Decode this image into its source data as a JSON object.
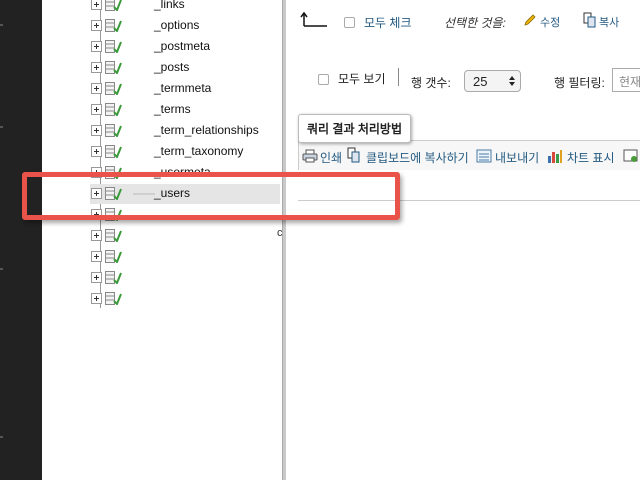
{
  "sidebar": {
    "tables": [
      {
        "name": "_links",
        "selected": false
      },
      {
        "name": "_options",
        "selected": false
      },
      {
        "name": "_postmeta",
        "selected": false
      },
      {
        "name": "_posts",
        "selected": false
      },
      {
        "name": "_termmeta",
        "selected": false
      },
      {
        "name": "_terms",
        "selected": false
      },
      {
        "name": "_term_relationships",
        "selected": false
      },
      {
        "name": "_term_taxonomy",
        "selected": false
      },
      {
        "name": "_usermeta",
        "selected": false
      },
      {
        "name": "_users",
        "selected": true
      },
      {
        "name": "",
        "selected": false
      },
      {
        "name": "",
        "selected": false
      },
      {
        "name": "",
        "selected": false
      },
      {
        "name": "",
        "selected": false
      },
      {
        "name": "",
        "selected": false
      }
    ],
    "trailing_char": "c"
  },
  "toolbar": {
    "check_all_label": "모두 체크",
    "with_selected_label": "선택한 것을:",
    "edit_label": "수정",
    "copy_label": "복사"
  },
  "display": {
    "show_all_label": "모두 보기",
    "rows_label": "행 갯수:",
    "rows_value": "25",
    "filter_label": "행 필터링:",
    "filter_placeholder": "현재"
  },
  "query_ops": {
    "legend": "쿼리 결과 처리방법",
    "print_label": "인쇄",
    "clipboard_label": "클립보드에 복사하기",
    "export_label": "내보내기",
    "chart_label": "차트 표시"
  },
  "colors": {
    "highlight": "#e9534a",
    "link": "#235a81",
    "sidebar_dark": "#222222"
  }
}
